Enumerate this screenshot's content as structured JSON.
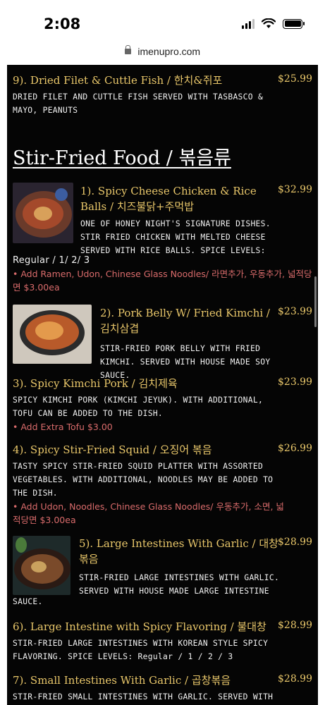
{
  "status_bar": {
    "time": "2:08"
  },
  "browser": {
    "url": "imenupro.com"
  },
  "section": {
    "title": "Stir-Fried Food / 볶음류"
  },
  "items": [
    {
      "title": "9). Dried Filet & Cuttle Fish / 한치&쥐포",
      "price": "$25.99",
      "desc": "DRIED FILET AND CUTTLE FISH SERVED WITH TASBASCO & MAYO, PEANUTS"
    },
    {
      "title": "1). Spicy Cheese Chicken & Rice Balls / 치즈불닭+주먹밥",
      "price": "$32.99",
      "desc": "ONE OF HONEY NIGHT'S SIGNATURE DISHES. STIR FRIED CHICKEN WITH MELTED CHEESE SERVED WITH RICE BALLS. SPICE LEVELS:",
      "desc2": "Regular / 1/ 2/ 3",
      "addon": "• Add Ramen, Udon, Chinese Glass Noodles/ 라면추가, 우동추가, 넓적당면 $3.00ea"
    },
    {
      "title": "2). Pork Belly W/ Fried Kimchi / 김치삼겹",
      "price": "$23.99",
      "desc": "STIR-FRIED PORK BELLY WITH FRIED KIMCHI. SERVED WITH HOUSE MADE SOY SAUCE."
    },
    {
      "title": "3). Spicy Kimchi Pork / 김치제육",
      "price": "$23.99",
      "desc": "SPICY KIMCHI PORK (KIMCHI JEYUK). WITH ADDITIONAL, TOFU CAN BE ADDED TO THE DISH.",
      "addon": "• Add Extra Tofu $3.00"
    },
    {
      "title": "4). Spicy Stir-Fried Squid / 오징어 볶음",
      "price": "$26.99",
      "desc": "TASTY SPICY STIR-FRIED SQUID PLATTER WITH ASSORTED VEGETABLES. WITH ADDITIONAL, NOODLES MAY BE ADDED TO THE DISH.",
      "addon": "• Add Udon, Noodles, Chinese Glass Noodles/ 우동추가, 소면, 넓적당면 $3.00ea"
    },
    {
      "title": "5). Large Intestines With Garlic / 대창볶음",
      "price": "$28.99",
      "desc": "STIR-FRIED LARGE INTESTINES WITH GARLIC. SERVED WITH HOUSE MADE LARGE INTESTINE",
      "desc2": "SAUCE."
    },
    {
      "title": "6). Large Intestine with Spicy Flavoring / 불대창",
      "price": "$28.99",
      "desc": "STIR-FRIED LARGE INTESTINES WITH KOREAN STYLE SPICY FLAVORING. SPICE LEVELS: Regular / 1 / 2 / 3"
    },
    {
      "title": "7). Small Intestines With Garlic / 곱창볶음",
      "price": "$28.99",
      "desc": "STIR-FRIED SMALL INTESTINES WITH GARLIC. SERVED WITH"
    }
  ]
}
